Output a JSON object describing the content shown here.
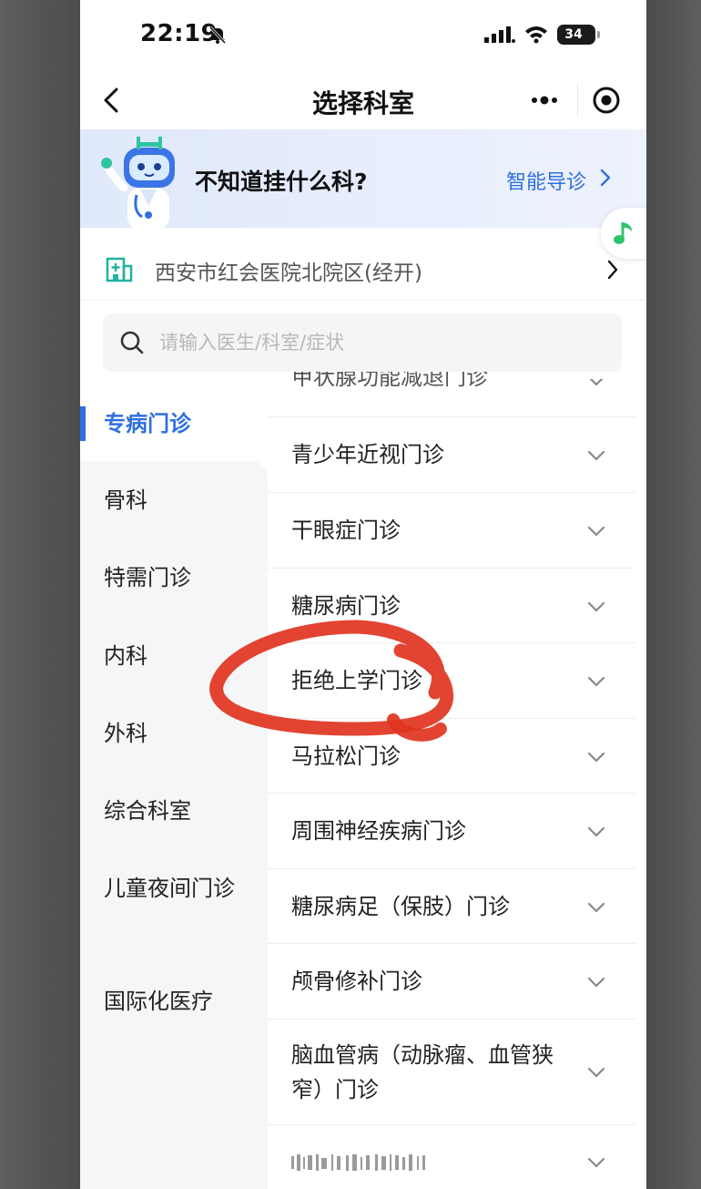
{
  "status_bar": {
    "time": "22:19",
    "battery": "34",
    "icons": [
      "bell-off-icon",
      "signal-icon",
      "wifi-icon",
      "battery-icon"
    ]
  },
  "nav": {
    "title": "选择科室",
    "icons": [
      "back-icon",
      "more-icon",
      "target-icon"
    ]
  },
  "banner": {
    "question": "不知道挂什么科?",
    "guide_label": "智能导诊",
    "mascot": "doctor-robot-mascot"
  },
  "hospital": {
    "name": "西安市红会医院北院区(经开)",
    "icon": "hospital-icon"
  },
  "search": {
    "placeholder": "请输入医生/科室/症状",
    "value": ""
  },
  "sidebar": {
    "items": [
      {
        "label": "专病门诊",
        "active": true
      },
      {
        "label": "骨科"
      },
      {
        "label": "特需门诊"
      },
      {
        "label": "内科"
      },
      {
        "label": "外科"
      },
      {
        "label": "综合科室"
      },
      {
        "label": "儿童夜间门诊"
      },
      {
        "label": "国际化医疗"
      }
    ]
  },
  "list": {
    "partial_top": "甲状腺功能减退门诊",
    "items": [
      {
        "label": "青少年近视门诊"
      },
      {
        "label": "干眼症门诊"
      },
      {
        "label": "糖尿病门诊"
      },
      {
        "label": "拒绝上学门诊",
        "highlighted": true
      },
      {
        "label": "马拉松门诊"
      },
      {
        "label": "周围神经疾病门诊"
      },
      {
        "label": "糖尿病足（保肢）门诊"
      },
      {
        "label": "颅骨修补门诊"
      },
      {
        "label": "脑血管病（动脉瘤、血管狭窄）门诊"
      }
    ]
  },
  "colors": {
    "accent": "#2f6fe0",
    "hospital_icon": "#1fb3a3",
    "annotation": "#e0341f"
  }
}
